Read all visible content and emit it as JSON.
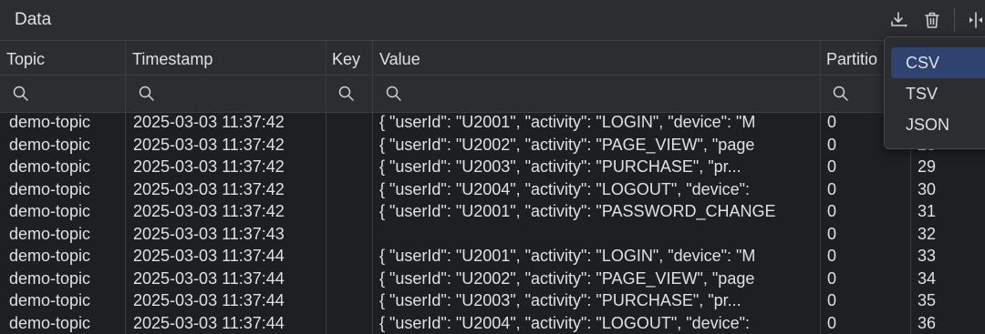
{
  "panel": {
    "title": "Data",
    "toolbar": {
      "download_icon": "download-icon",
      "delete_icon": "trash-icon",
      "split_icon": "split-view-icon"
    }
  },
  "table": {
    "columns": [
      "Topic",
      "Timestamp",
      "Key",
      "Value",
      "Partitio"
    ],
    "rows": [
      {
        "topic": "demo-topic",
        "timestamp": "2025-03-03 11:37:42",
        "key": "",
        "value": "{   \"userId\": \"U2001\",   \"activity\": \"LOGIN\",   \"device\": \"M",
        "partition": "0",
        "offset": ""
      },
      {
        "topic": "demo-topic",
        "timestamp": "2025-03-03 11:37:42",
        "key": "",
        "value": "{   \"userId\": \"U2002\",   \"activity\": \"PAGE_VIEW\",   \"page",
        "partition": "0",
        "offset": "28"
      },
      {
        "topic": "demo-topic",
        "timestamp": "2025-03-03 11:37:42",
        "key": "",
        "value": "{   \"userId\": \"U2003\",   \"activity\": \"PURCHASE\",   \"pr...",
        "partition": "0",
        "offset": "29"
      },
      {
        "topic": "demo-topic",
        "timestamp": "2025-03-03 11:37:42",
        "key": "",
        "value": "{   \"userId\": \"U2004\",   \"activity\": \"LOGOUT\",   \"device\":",
        "partition": "0",
        "offset": "30"
      },
      {
        "topic": "demo-topic",
        "timestamp": "2025-03-03 11:37:42",
        "key": "",
        "value": "{   \"userId\": \"U2001\",   \"activity\": \"PASSWORD_CHANGE",
        "partition": "0",
        "offset": "31"
      },
      {
        "topic": "demo-topic",
        "timestamp": "2025-03-03 11:37:43",
        "key": "",
        "value": "",
        "partition": "0",
        "offset": "32"
      },
      {
        "topic": "demo-topic",
        "timestamp": "2025-03-03 11:37:44",
        "key": "",
        "value": "{   \"userId\": \"U2001\",   \"activity\": \"LOGIN\",   \"device\": \"M",
        "partition": "0",
        "offset": "33"
      },
      {
        "topic": "demo-topic",
        "timestamp": "2025-03-03 11:37:44",
        "key": "",
        "value": "{   \"userId\": \"U2002\",   \"activity\": \"PAGE_VIEW\",   \"page",
        "partition": "0",
        "offset": "34"
      },
      {
        "topic": "demo-topic",
        "timestamp": "2025-03-03 11:37:44",
        "key": "",
        "value": "{   \"userId\": \"U2003\",   \"activity\": \"PURCHASE\",   \"pr...",
        "partition": "0",
        "offset": "35"
      },
      {
        "topic": "demo-topic",
        "timestamp": "2025-03-03 11:37:44",
        "key": "",
        "value": "{   \"userId\": \"U2004\",   \"activity\": \"LOGOUT\",   \"device\":",
        "partition": "0",
        "offset": "36"
      }
    ]
  },
  "export_menu": {
    "options": [
      "CSV",
      "TSV",
      "JSON"
    ],
    "selected": "CSV"
  },
  "colors": {
    "background": "#1e1f22",
    "panel": "#2b2d30",
    "selection": "#2e436e",
    "text": "#dfe1e5"
  }
}
